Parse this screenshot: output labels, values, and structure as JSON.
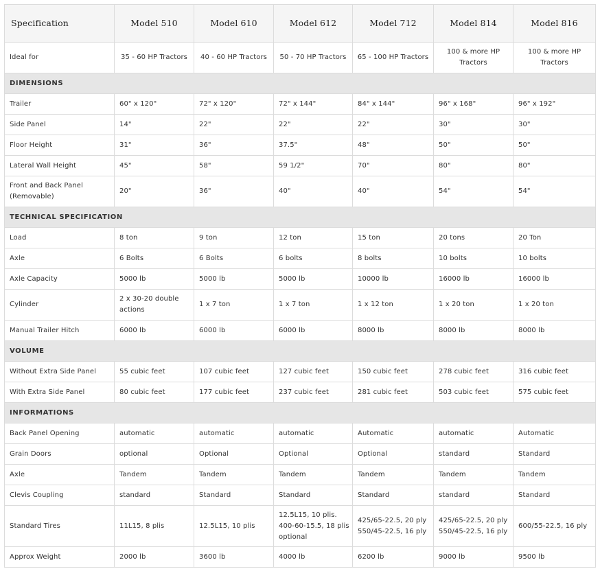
{
  "header": {
    "spec_label": "Specification",
    "models": [
      "Model 510",
      "Model 610",
      "Model 612",
      "Model 712",
      "Model 814",
      "Model 816"
    ]
  },
  "ideal_for": {
    "label": "Ideal for",
    "values": [
      "35 - 60 HP Tractors",
      "40 - 60 HP Tractors",
      "50 - 70 HP Tractors",
      "65 - 100 HP Tractors",
      "100 & more HP Tractors",
      "100 & more HP Tractors"
    ]
  },
  "sections": [
    {
      "title": "DIMENSIONS",
      "rows": [
        {
          "label": "Trailer",
          "values": [
            "60\" x 120\"",
            "72\" x 120\"",
            "72\" x 144\"",
            "84\" x 144\"",
            "96\" x 168\"",
            "96\" x 192\""
          ]
        },
        {
          "label": "Side Panel",
          "values": [
            "14\"",
            "22\"",
            "22\"",
            "22\"",
            "30\"",
            "30\""
          ]
        },
        {
          "label": "Floor Height",
          "values": [
            "31\"",
            "36\"",
            "37.5\"",
            "48\"",
            "50\"",
            "50\""
          ]
        },
        {
          "label": "Lateral Wall Height",
          "values": [
            "45\"",
            "58\"",
            "59 1/2\"",
            "70\"",
            "80\"",
            "80\""
          ]
        },
        {
          "label": "Front and Back Panel (Removable)",
          "values": [
            "20\"",
            "36\"",
            "40\"",
            "40\"",
            "54\"",
            "54\""
          ]
        }
      ]
    },
    {
      "title": "TECHNICAL SPECIFICATION",
      "rows": [
        {
          "label": "Load",
          "values": [
            "8 ton",
            "9 ton",
            "12 ton",
            "15 ton",
            "20 tons",
            "20 Ton"
          ]
        },
        {
          "label": "Axle",
          "values": [
            "6 Bolts",
            "6 Bolts",
            "6 bolts",
            "8 bolts",
            "10 bolts",
            "10 bolts"
          ]
        },
        {
          "label": "Axle Capacity",
          "values": [
            "5000 lb",
            "5000 lb",
            "5000 lb",
            "10000 lb",
            "16000 lb",
            "16000 lb"
          ]
        },
        {
          "label": "Cylinder",
          "values": [
            "2 x 30-20 double actions",
            "1 x 7 ton",
            "1 x 7 ton",
            "1 x 12 ton",
            "1 x 20 ton",
            "1 x 20 ton"
          ]
        },
        {
          "label": "Manual Trailer Hitch",
          "values": [
            "6000 lb",
            "6000 lb",
            "6000 lb",
            "8000 lb",
            "8000 lb",
            "8000 lb"
          ]
        }
      ]
    },
    {
      "title": "VOLUME",
      "rows": [
        {
          "label": "Without Extra Side Panel",
          "values": [
            "55 cubic feet",
            "107 cubic feet",
            "127 cubic feet",
            "150 cubic feet",
            "278 cubic feet",
            "316 cubic feet"
          ]
        },
        {
          "label": "With Extra Side Panel",
          "values": [
            "80 cubic feet",
            "177 cubic feet",
            "237 cubic feet",
            "281 cubic feet",
            "503 cubic feet",
            "575 cubic feet"
          ]
        }
      ]
    },
    {
      "title": "INFORMATIONS",
      "rows": [
        {
          "label": "Back Panel Opening",
          "values": [
            "automatic",
            "automatic",
            "automatic",
            "Automatic",
            "automatic",
            "Automatic"
          ]
        },
        {
          "label": "Grain Doors",
          "values": [
            "optional",
            "Optional",
            "Optional",
            "Optional",
            "standard",
            "Standard"
          ]
        },
        {
          "label": "Axle",
          "values": [
            "Tandem",
            "Tandem",
            "Tandem",
            "Tandem",
            "Tandem",
            "Tandem"
          ]
        },
        {
          "label": "Clevis Coupling",
          "values": [
            "standard",
            "Standard",
            "Standard",
            "Standard",
            "standard",
            "Standard"
          ]
        },
        {
          "label": "Standard Tires",
          "values": [
            "11L15, 8 plis",
            "12.5L15, 10 plis",
            "12.5L15, 10 plis. 400-60-15.5, 18 plis optional",
            "425/65-22.5, 20 ply 550/45-22.5, 16 ply",
            "425/65-22.5, 20 ply 550/45-22.5, 16 ply",
            "600/55-22.5, 16 ply"
          ]
        },
        {
          "label": "Approx Weight",
          "values": [
            "2000 lb",
            "3600 lb",
            "4000 lb",
            "6200 lb",
            "9000 lb",
            "9500 lb"
          ]
        }
      ]
    }
  ]
}
